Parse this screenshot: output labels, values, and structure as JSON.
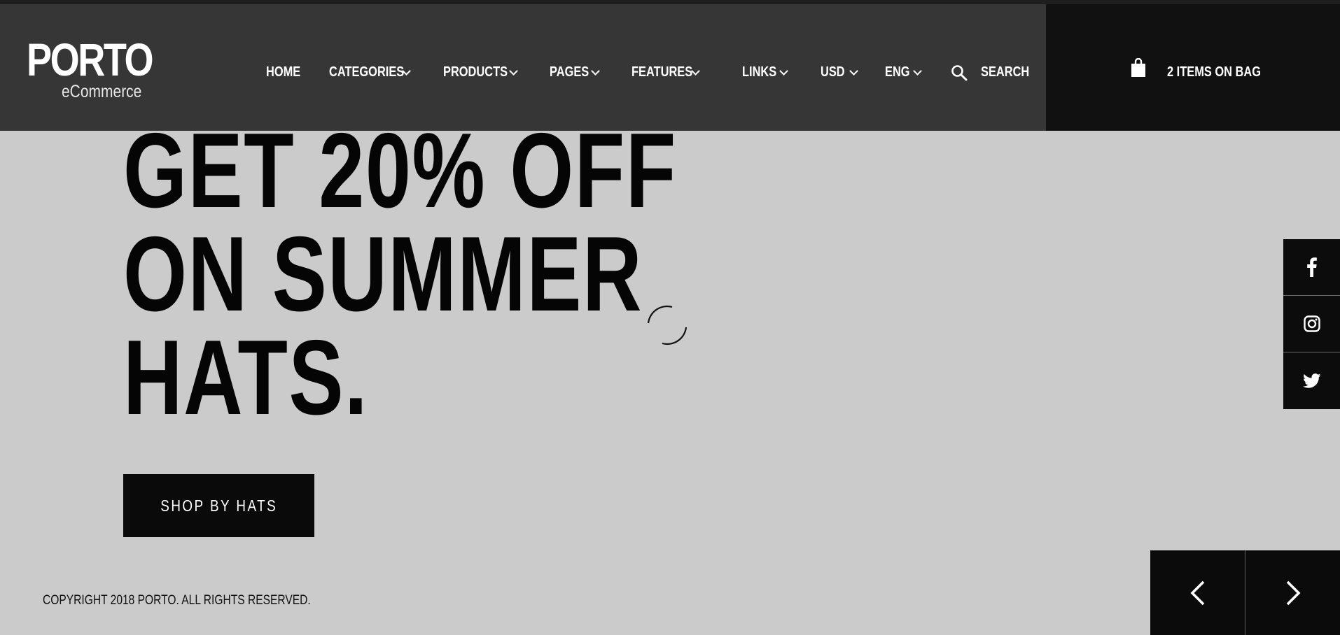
{
  "brand": {
    "name": "PORTO",
    "tagline": "eCommerce"
  },
  "nav": {
    "items": [
      {
        "label": "HOME",
        "dropdown": false
      },
      {
        "label": "CATEGORIES",
        "dropdown": true
      },
      {
        "label": "PRODUCTS",
        "dropdown": true
      },
      {
        "label": "PAGES",
        "dropdown": true
      },
      {
        "label": "FEATURES",
        "dropdown": true
      },
      {
        "label": "LINKS",
        "dropdown": true
      },
      {
        "label": "USD",
        "dropdown": true
      },
      {
        "label": "ENG",
        "dropdown": true
      }
    ],
    "search_label": "SEARCH"
  },
  "cart": {
    "label": "2 ITEMS ON BAG"
  },
  "hero": {
    "lines": [
      "GET 20% OFF",
      "ON SUMMER",
      "HATS."
    ],
    "cta_label": "SHOP BY HATS"
  },
  "social": [
    "facebook-icon",
    "instagram-icon",
    "twitter-icon"
  ],
  "footer": {
    "copyright": "COPYRIGHT 2018 PORTO. ALL RIGHTS RESERVED."
  },
  "colors": {
    "header_bg": "#363636",
    "bag_bg": "#111111",
    "page_bg": "#cbcbcb",
    "button_bg": "#0a0a0a"
  }
}
